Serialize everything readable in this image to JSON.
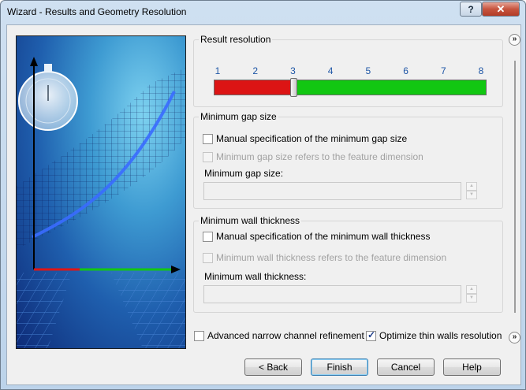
{
  "window": {
    "title": "Wizard - Results and Geometry Resolution",
    "help_label": "?",
    "close_label": "✕"
  },
  "result_resolution": {
    "title": "Result resolution",
    "ticks": [
      "1",
      "2",
      "3",
      "4",
      "5",
      "6",
      "7",
      "8"
    ],
    "min": 1,
    "max": 8,
    "value": 3,
    "colors": {
      "low": "#dc1414",
      "high": "#12c712"
    }
  },
  "min_gap": {
    "title": "Minimum gap size",
    "manual_label": "Manual specification of the minimum gap size",
    "manual_checked": false,
    "feature_label": "Minimum gap size refers to the feature dimension",
    "feature_checked": false,
    "field_label": "Minimum gap size:",
    "field_value": ""
  },
  "min_wall": {
    "title": "Minimum wall thickness",
    "manual_label": "Manual specification of the minimum wall thickness",
    "manual_checked": false,
    "feature_label": "Minimum wall thickness refers to the feature dimension",
    "feature_checked": false,
    "field_label": "Minimum wall thickness:",
    "field_value": ""
  },
  "options": {
    "narrow_label": "Advanced narrow channel refinement",
    "narrow_checked": false,
    "thin_label": "Optimize thin walls resolution",
    "thin_checked": true
  },
  "buttons": {
    "back": "< Back",
    "finish": "Finish",
    "cancel": "Cancel",
    "help": "Help"
  },
  "icons": {
    "collapse": "double-chevron-up-icon",
    "expand": "double-chevron-down-icon"
  }
}
